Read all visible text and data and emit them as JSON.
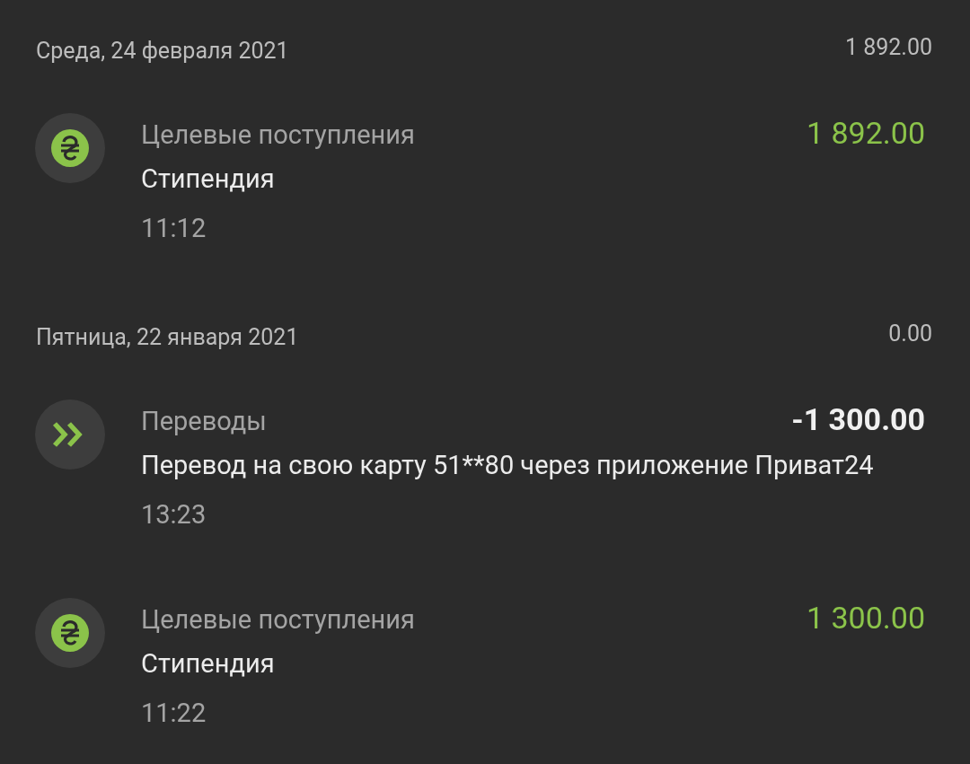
{
  "days": [
    {
      "date": "Среда, 24 февраля 2021",
      "total": "1 892.00",
      "transactions": [
        {
          "kind": "income",
          "category": "Целевые поступления",
          "amount": "1 892.00",
          "description": "Стипендия",
          "time": "11:12"
        }
      ]
    },
    {
      "date": "Пятница, 22 января 2021",
      "total": "0.00",
      "transactions": [
        {
          "kind": "transfer",
          "category": "Переводы",
          "amount": "-1 300.00",
          "description": "Перевод на свою карту 51**80 через приложение Приват24",
          "time": "13:23"
        },
        {
          "kind": "income",
          "category": "Целевые поступления",
          "amount": "1 300.00",
          "description": "Стипендия",
          "time": "11:22"
        }
      ]
    }
  ]
}
